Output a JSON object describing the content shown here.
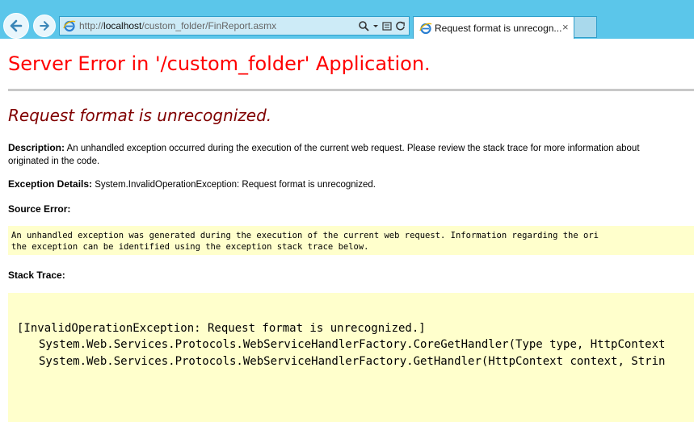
{
  "browser": {
    "url_prefix": "http://",
    "url_host": "localhost",
    "url_path": "/custom_folder/FinReport.asmx",
    "tab_title": "Request format is unrecogn...",
    "tab_close": "×",
    "icons": [
      "back-arrow-icon",
      "forward-arrow-icon",
      "ie-logo-icon",
      "search-icon",
      "dropdown-chevron-icon",
      "compatibility-view-icon",
      "refresh-icon",
      "close-icon"
    ]
  },
  "page": {
    "title": "Server Error in '/custom_folder' Application.",
    "error_heading": "Request format is unrecognized.",
    "description_label": "Description:",
    "description_text": " An unhandled exception occurred during the execution of the current web request. Please review the stack trace for more information about",
    "description_text_2": "originated in the code.",
    "exception_label": "Exception Details:",
    "exception_text": " System.InvalidOperationException: Request format is unrecognized.",
    "source_error_label": "Source Error:",
    "source_error_line1": "An unhandled exception was generated during the execution of the current web request. Information regarding the ori",
    "source_error_line2": "the exception can be identified using the exception stack trace below.",
    "stack_trace_label": "Stack Trace:",
    "stack_line1": "[InvalidOperationException: Request format is unrecognized.]",
    "stack_line2": "System.Web.Services.Protocols.WebServiceHandlerFactory.CoreGetHandler(Type type, HttpContext",
    "stack_line3": "System.Web.Services.Protocols.WebServiceHandlerFactory.GetHandler(HttpContext context, Strin"
  },
  "colors": {
    "chrome_bg": "#5bc6ea",
    "title_red": "#ff0000",
    "heading_maroon": "#800000",
    "code_bg": "#ffffcc"
  }
}
